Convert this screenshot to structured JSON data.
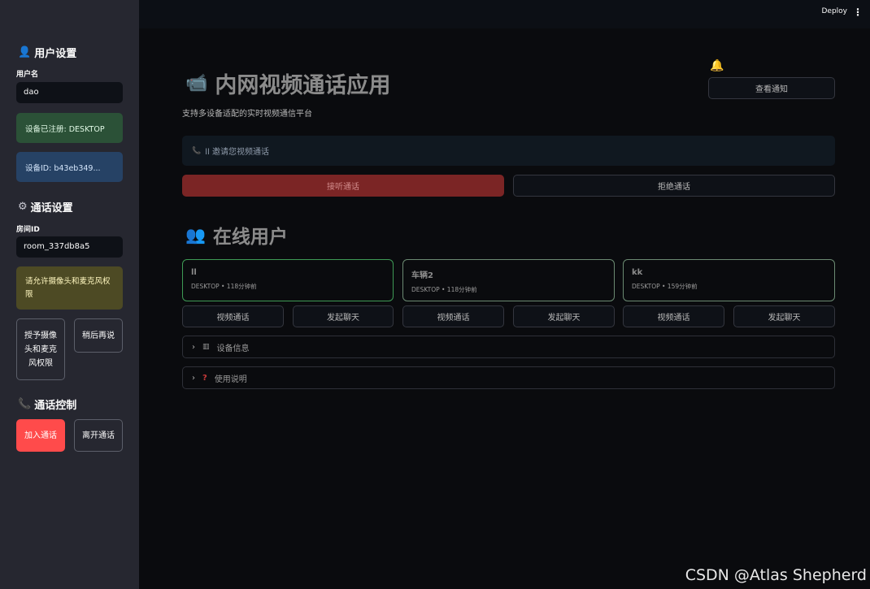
{
  "sidebar": {
    "user_settings_title": "用户设置",
    "username_label": "用户名",
    "username_value": "dao",
    "device_registered": "设备已注册: DESKTOP",
    "device_id": "设备ID: b43eb349...",
    "call_settings_title": "通话设置",
    "room_label": "房间ID",
    "room_value": "room_337db8a5",
    "permission_warning": "请允许摄像头和麦克风权限",
    "grant_permission_button": "授予摄像头和麦克风权限",
    "later_button": "稍后再说",
    "call_control_title": "通话控制",
    "join_button": "加入通话",
    "leave_button": "离开通话"
  },
  "topbar": {
    "deploy_label": "Deploy",
    "menu_icon": "⋮"
  },
  "main": {
    "title": "内网视频通话应用",
    "subtitle": "支持多设备适配的实时视频通信平台",
    "view_notifications_button": "查看通知",
    "invite_message": "ll 邀请您视频通话",
    "accept_button": "接听通话",
    "reject_button": "拒绝通话",
    "online_users_title": "在线用户",
    "users": [
      {
        "name": "ll",
        "meta": "DESKTOP • 118分钟前"
      },
      {
        "name": "车辆2",
        "meta": "DESKTOP • 118分钟前"
      },
      {
        "name": "kk",
        "meta": "DESKTOP • 159分钟前"
      }
    ],
    "video_call_label": "视频通话",
    "chat_label": "发起聊天",
    "expander_device_info": "设备信息",
    "expander_usage": "使用说明"
  },
  "watermark": "CSDN @Atlas Shepherd",
  "colors": {
    "primary": "#ff4b4b",
    "sidebar_bg": "#262730",
    "main_bg": "#0a0b0e"
  }
}
